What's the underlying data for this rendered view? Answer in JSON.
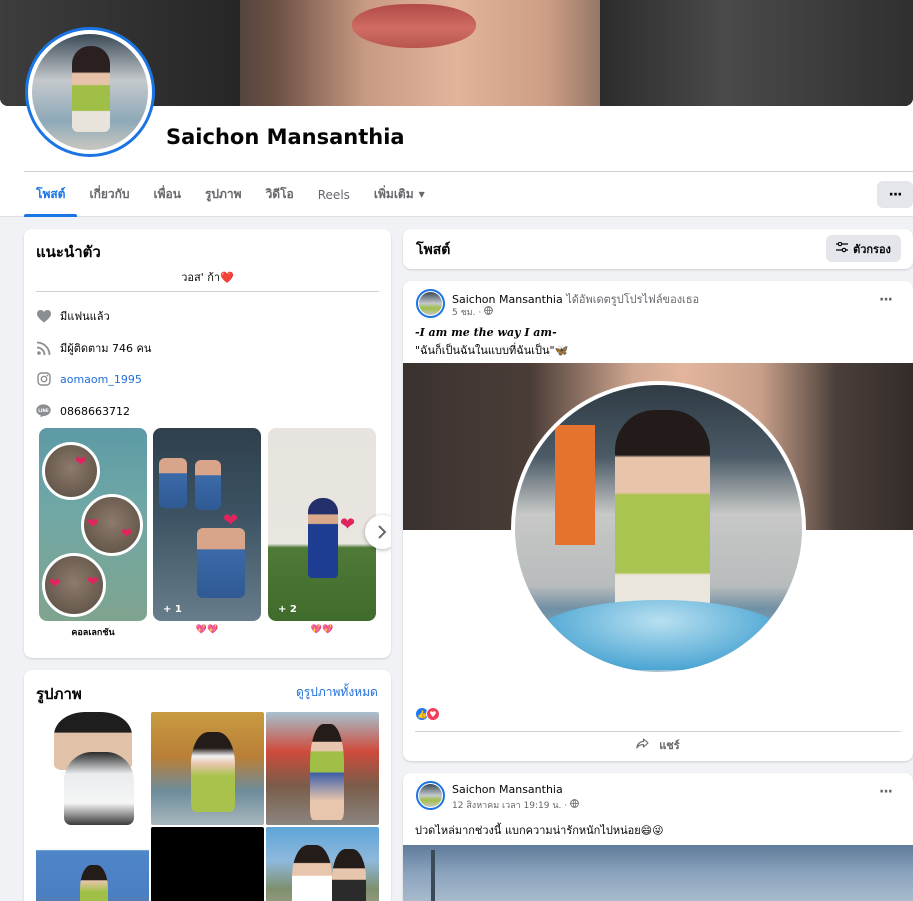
{
  "profile": {
    "name": "Saichon Mansanthia"
  },
  "tabs": [
    {
      "label": "โพสต์",
      "active": true
    },
    {
      "label": "เกี่ยวกับ"
    },
    {
      "label": "เพื่อน"
    },
    {
      "label": "รูปภาพ"
    },
    {
      "label": "วิดีโอ"
    },
    {
      "label": "Reels"
    },
    {
      "label": "เพิ่มเติม"
    }
  ],
  "more_button": "···",
  "intro": {
    "title": "แนะนำตัว",
    "bio": "วอส' ก้า❤️",
    "relationship": "มีแฟนแล้ว",
    "followers": "มีผู้ติดตาม 746 คน",
    "instagram": "aomaom_1995",
    "line": "0868663712",
    "highlights": [
      {
        "caption": "คอลเลกชัน",
        "count": ""
      },
      {
        "caption": "💖💖",
        "count": "+ 1"
      },
      {
        "caption": "💖💖",
        "count": "+ 2"
      }
    ]
  },
  "photos": {
    "title": "รูปภาพ",
    "see_all": "ดูรูปภาพทั้งหมด"
  },
  "posts_header": {
    "title": "โพสต์",
    "filter_label": "ตัวกรอง"
  },
  "post1": {
    "author": "Saichon Mansanthia",
    "action": " ได้อัพเดตรูปโปรไฟล์ของเธอ",
    "time": "5 ชม. ·",
    "line1": "-I am me the way I am-",
    "line2": "\"ฉันก็เป็นฉันในแบบที่ฉันเป็น\"🦋",
    "share_label": "แชร์"
  },
  "post2": {
    "author": "Saichon Mansanthia",
    "time": "12 สิงหาคม เวลา 19:19 น. ·",
    "text": "ปวดไหล่มากช่วงนี้ แบกความน่ารักหนักไปหน่อย😄😜"
  },
  "colors": {
    "accent": "#1b74e4",
    "background": "#f0f2f5",
    "like": "#1877f2",
    "love": "#f33e58"
  },
  "icons": [
    "heart-icon",
    "rss-icon",
    "instagram-icon",
    "line-icon",
    "chevron-right-icon",
    "filter-icon",
    "globe-icon",
    "share-icon",
    "more-dots-icon"
  ]
}
